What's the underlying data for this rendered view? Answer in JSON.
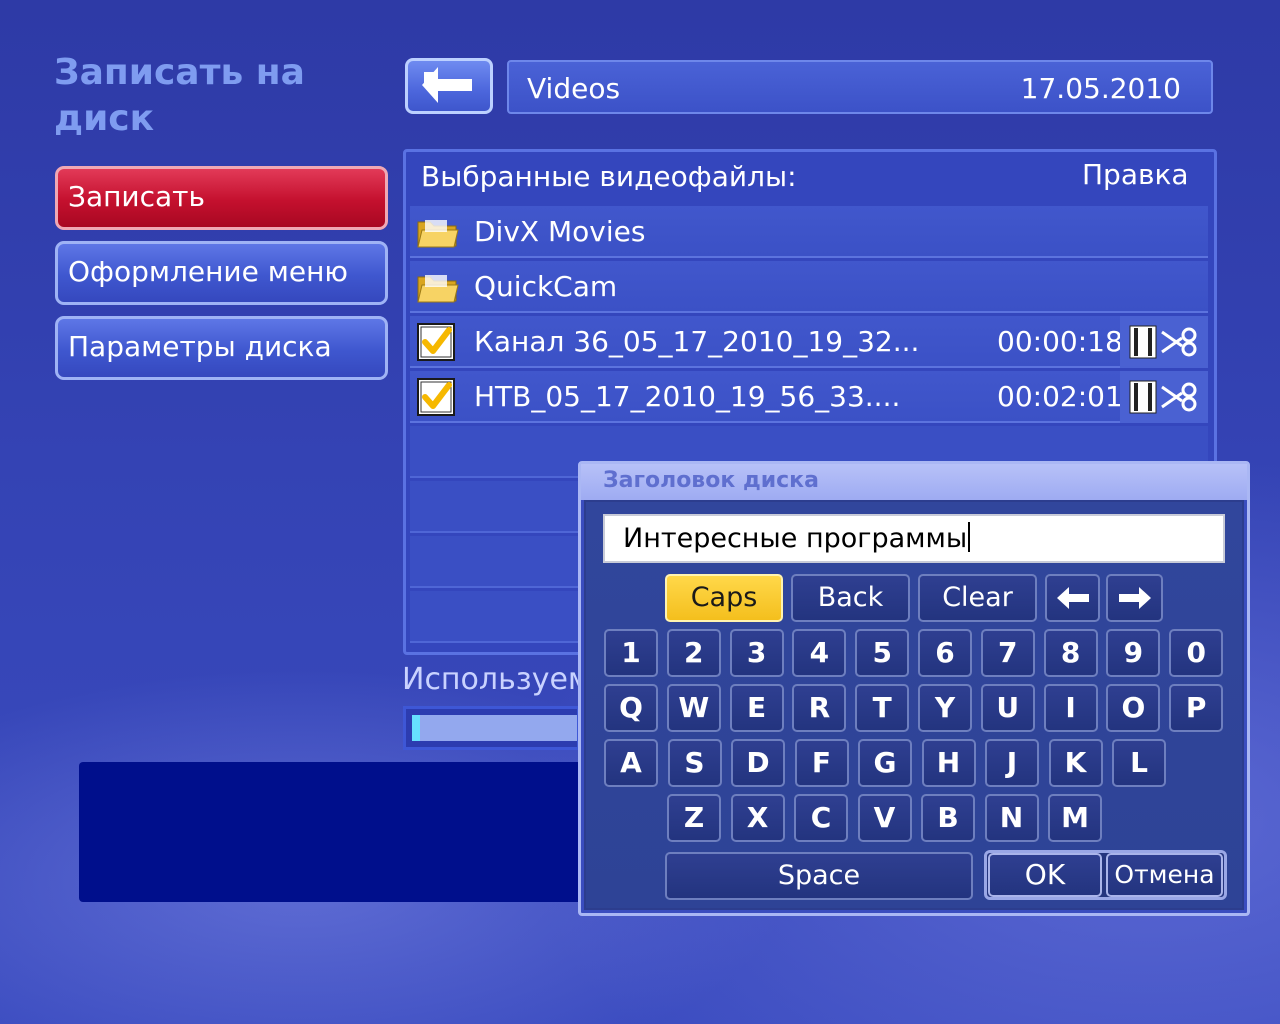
{
  "page_title": "Записать на диск",
  "menu": {
    "burn": "Записать",
    "menu_design": "Оформление меню",
    "disc_params": "Параметры диска"
  },
  "header": {
    "folder": "Videos",
    "date": "17.05.2010"
  },
  "list": {
    "heading": "Выбранные видеофайлы:",
    "edit": "Правка",
    "items": [
      {
        "type": "folder",
        "name": "DivX Movies"
      },
      {
        "type": "folder",
        "name": "QuickCam"
      },
      {
        "type": "video",
        "name": "Канал 36_05_17_2010_19_32...",
        "duration": "00:00:18",
        "checked": true
      },
      {
        "type": "video",
        "name": "НТВ_05_17_2010_19_56_33....",
        "duration": "00:02:01",
        "checked": true
      }
    ]
  },
  "usage": {
    "label": "Используемо",
    "fraction": 0.02
  },
  "dialog": {
    "title": "Заголовок диска",
    "input_value": "Интересные программы",
    "keys": {
      "caps": "Caps",
      "back": "Back",
      "clear": "Clear",
      "left_arrow": "←",
      "right_arrow": "→",
      "digits": [
        "1",
        "2",
        "3",
        "4",
        "5",
        "6",
        "7",
        "8",
        "9",
        "0"
      ],
      "row1": [
        "Q",
        "W",
        "E",
        "R",
        "T",
        "Y",
        "U",
        "I",
        "O",
        "P"
      ],
      "row2": [
        "A",
        "S",
        "D",
        "F",
        "G",
        "H",
        "J",
        "K",
        "L"
      ],
      "row3": [
        "Z",
        "X",
        "C",
        "V",
        "B",
        "N",
        "M"
      ],
      "space": "Space",
      "ok": "OK",
      "cancel": "Отмена"
    }
  },
  "colors": {
    "background": "#3443b4",
    "accent_red": "#c4102e",
    "caps_yellow": "#f4bf1d",
    "check_yellow": "#f6b800"
  }
}
